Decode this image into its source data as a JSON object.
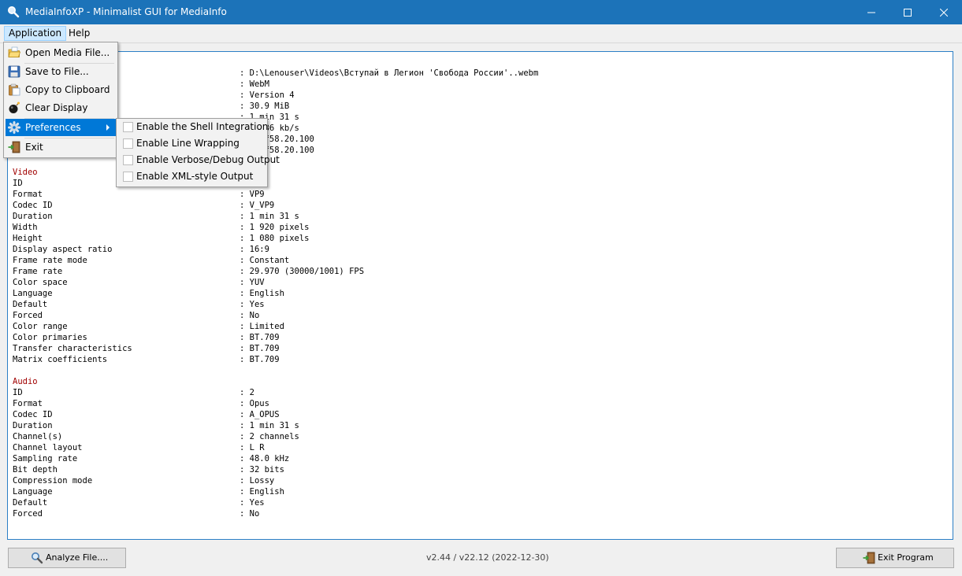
{
  "window": {
    "title": "MediaInfoXP - Minimalist GUI for MediaInfo",
    "icon": "magnifier-icon",
    "controls": {
      "minimize": "minimize-icon",
      "maximize": "maximize-icon",
      "close": "close-icon"
    }
  },
  "menubar": {
    "application": "Application",
    "help": "Help"
  },
  "app_menu": {
    "open": "Open Media File...",
    "save": "Save to File...",
    "copy": "Copy to Clipboard",
    "clear": "Clear Display",
    "preferences": "Preferences",
    "exit": "Exit",
    "icons": {
      "open": "open-folder-icon",
      "save": "floppy-disk-icon",
      "copy": "clipboard-icon",
      "clear": "bomb-icon",
      "preferences": "gear-icon",
      "exit": "exit-door-icon",
      "submenu_arrow": "chevron-right-icon"
    }
  },
  "preferences_menu": {
    "items": [
      {
        "label": "Enable the Shell Integration",
        "checked": false
      },
      {
        "label": "Enable Line Wrapping",
        "checked": false
      },
      {
        "label": "Enable Verbose/Debug Output",
        "checked": false
      },
      {
        "label": "Enable XML-style Output",
        "checked": false
      }
    ]
  },
  "general_values": [
    "D:\\Lenouser\\Videos\\Вступай в Легион 'Свобода России'..webm",
    "WebM",
    "Version 4",
    "30.9 MiB",
    "1 min 31 s",
    "2 836 kb/s",
    "Lavf58.20.100",
    "Lavf58.20.100"
  ],
  "info": {
    "video_header": "Video",
    "video": [
      {
        "k": "ID",
        "v": ""
      },
      {
        "k": "Format",
        "v": "VP9"
      },
      {
        "k": "Codec ID",
        "v": "V_VP9"
      },
      {
        "k": "Duration",
        "v": "1 min 31 s"
      },
      {
        "k": "Width",
        "v": "1 920 pixels"
      },
      {
        "k": "Height",
        "v": "1 080 pixels"
      },
      {
        "k": "Display aspect ratio",
        "v": "16:9"
      },
      {
        "k": "Frame rate mode",
        "v": "Constant"
      },
      {
        "k": "Frame rate",
        "v": "29.970 (30000/1001) FPS"
      },
      {
        "k": "Color space",
        "v": "YUV"
      },
      {
        "k": "Language",
        "v": "English"
      },
      {
        "k": "Default",
        "v": "Yes"
      },
      {
        "k": "Forced",
        "v": "No"
      },
      {
        "k": "Color range",
        "v": "Limited"
      },
      {
        "k": "Color primaries",
        "v": "BT.709"
      },
      {
        "k": "Transfer characteristics",
        "v": "BT.709"
      },
      {
        "k": "Matrix coefficients",
        "v": "BT.709"
      }
    ],
    "audio_header": "Audio",
    "audio": [
      {
        "k": "ID",
        "v": "2"
      },
      {
        "k": "Format",
        "v": "Opus"
      },
      {
        "k": "Codec ID",
        "v": "A_OPUS"
      },
      {
        "k": "Duration",
        "v": "1 min 31 s"
      },
      {
        "k": "Channel(s)",
        "v": "2 channels"
      },
      {
        "k": "Channel layout",
        "v": "L R"
      },
      {
        "k": "Sampling rate",
        "v": "48.0 kHz"
      },
      {
        "k": "Bit depth",
        "v": "32 bits"
      },
      {
        "k": "Compression mode",
        "v": "Lossy"
      },
      {
        "k": "Language",
        "v": "English"
      },
      {
        "k": "Default",
        "v": "Yes"
      },
      {
        "k": "Forced",
        "v": "No"
      }
    ]
  },
  "footer": {
    "analyze": "Analyze File....",
    "version": "v2.44 / v22.12 (2022-12-30)",
    "exit": "Exit Program",
    "analyze_icon": "magnifier-icon",
    "exit_icon": "exit-door-icon"
  },
  "colors": {
    "titlebar": "#1c73b9",
    "section_header": "#a00000",
    "highlight": "#0078d7",
    "output_border": "#2c7fc6"
  }
}
